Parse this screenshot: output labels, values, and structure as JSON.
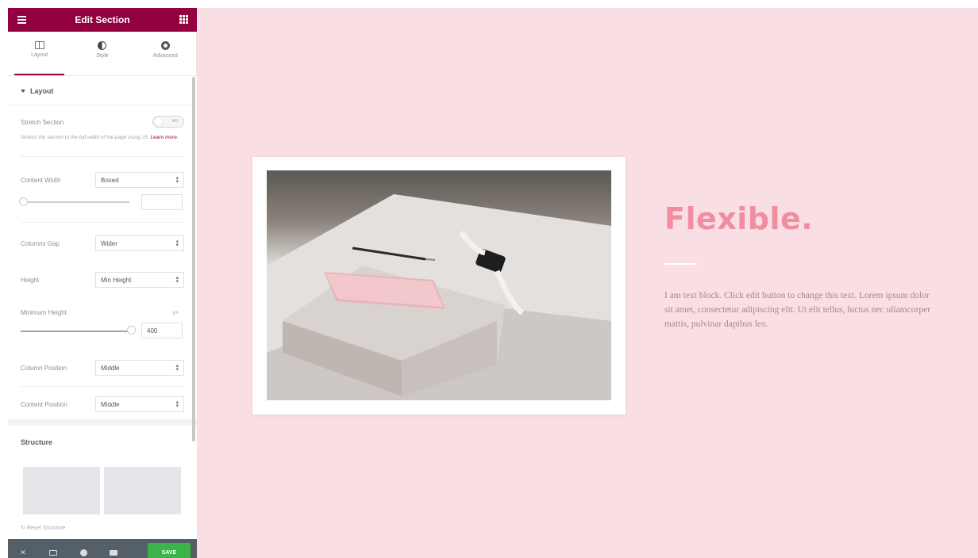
{
  "editor": {
    "title": "Edit Section",
    "tabs": [
      {
        "label": "Layout",
        "icon": "layout-icon",
        "active": true
      },
      {
        "label": "Style",
        "icon": "style-icon",
        "active": false
      },
      {
        "label": "Advanced",
        "icon": "gear-icon",
        "active": false
      }
    ],
    "layout_section": {
      "title": "Layout",
      "stretch_section": {
        "label": "Stretch Section",
        "toggle_text": "NO",
        "description": "Stretch the section to the full width of the page using JS.",
        "learn_more": "Learn more."
      },
      "content_width": {
        "label": "Content Width",
        "value": "Boxed"
      },
      "columns_gap": {
        "label": "Columns Gap",
        "value": "Wider"
      },
      "height": {
        "label": "Height",
        "value": "Min Height"
      },
      "minimum_height": {
        "label": "Minimum Height",
        "unit": "px",
        "value": "400"
      },
      "column_position": {
        "label": "Column Position",
        "value": "Middle"
      },
      "content_position": {
        "label": "Content Position",
        "value": "Middle"
      }
    },
    "structure_section": {
      "title": "Structure",
      "reset_label": "Reset Structure"
    },
    "footer": {
      "save_label": "SAVE"
    }
  },
  "canvas": {
    "heading": "Flexible.",
    "body": "I am text block. Click edit button to change this text. Lorem ipsum dolor sit amet, consectetur adipiscing elit. Ut elit tellus, luctus nec ullamcorper mattis, pulvinar dapibus leo."
  },
  "colors": {
    "brand": "#93003f",
    "canvas_bg": "#f9dfe4",
    "heading": "#f08da0",
    "save": "#39b54a",
    "footer_bar": "#555f68"
  }
}
